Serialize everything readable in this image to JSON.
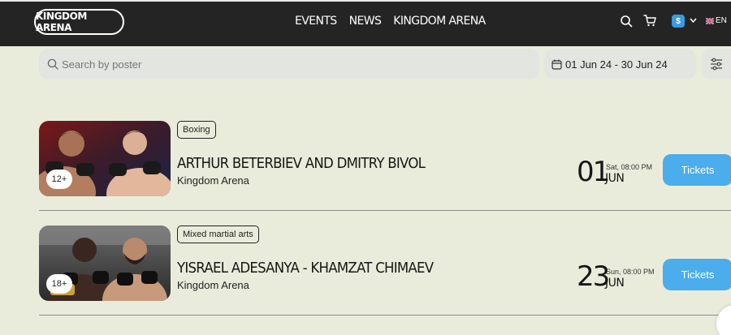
{
  "header": {
    "logo": "KINGDOM ARENA",
    "nav": [
      "EVENTS",
      "NEWS",
      "KINGDOM ARENA"
    ],
    "currency_symbol": "$",
    "language": "EN"
  },
  "filters": {
    "search_placeholder": "Search by poster",
    "date_range": "01 Jun 24 - 30 Jun 24"
  },
  "events": [
    {
      "category": "Boxing",
      "title": "ARTHUR BETERBIEV AND DMITRY BIVOL",
      "venue": "Kingdom Arena",
      "age": "12+",
      "day": "01",
      "time": "Sat, 08:00 PM",
      "month": "JUN",
      "button": "Tickets"
    },
    {
      "category": "Mixed martial arts",
      "title": "YISRAEL ADESANYA - KHAMZAT CHIMAEV",
      "venue": "Kingdom Arena",
      "age": "18+",
      "day": "23",
      "time": "Sun, 08:00 PM",
      "month": "JUN",
      "button": "Tickets"
    }
  ],
  "colors": {
    "page_bg": "#e9ecdb",
    "navbar_bg": "#242424",
    "accent": "#4badeb"
  }
}
